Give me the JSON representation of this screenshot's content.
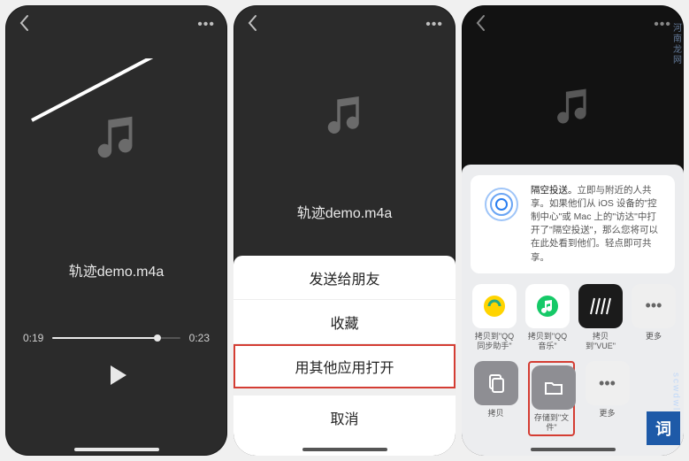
{
  "filename": "轨迹demo.m4a",
  "time": {
    "current": "0:19",
    "total": "0:23",
    "progress_pct": 82
  },
  "actionsheet": {
    "send_friend": "发送给朋友",
    "favorite": "收藏",
    "open_other": "用其他应用打开",
    "cancel": "取消"
  },
  "airdrop": {
    "title": "隔空投送。",
    "body": "立即与附近的人共享。如果他们从 iOS 设备的\"控制中心\"或 Mac 上的\"访达\"中打开了\"隔空投送\"，那么您将可以在此处看到他们。轻点即可共享。"
  },
  "apps": {
    "qqsync": "拷贝到\"QQ同步助手\"",
    "qqmusic": "拷贝到\"QQ音乐\"",
    "vue": "拷贝到\"VUE\"",
    "more": "更多"
  },
  "actions": {
    "copy": "拷贝",
    "save_files": "存储到\"文件\"",
    "more": "更多"
  },
  "watermark": {
    "side": "scwdwl.com",
    "text_top": "河南龙网",
    "corner": "词"
  }
}
